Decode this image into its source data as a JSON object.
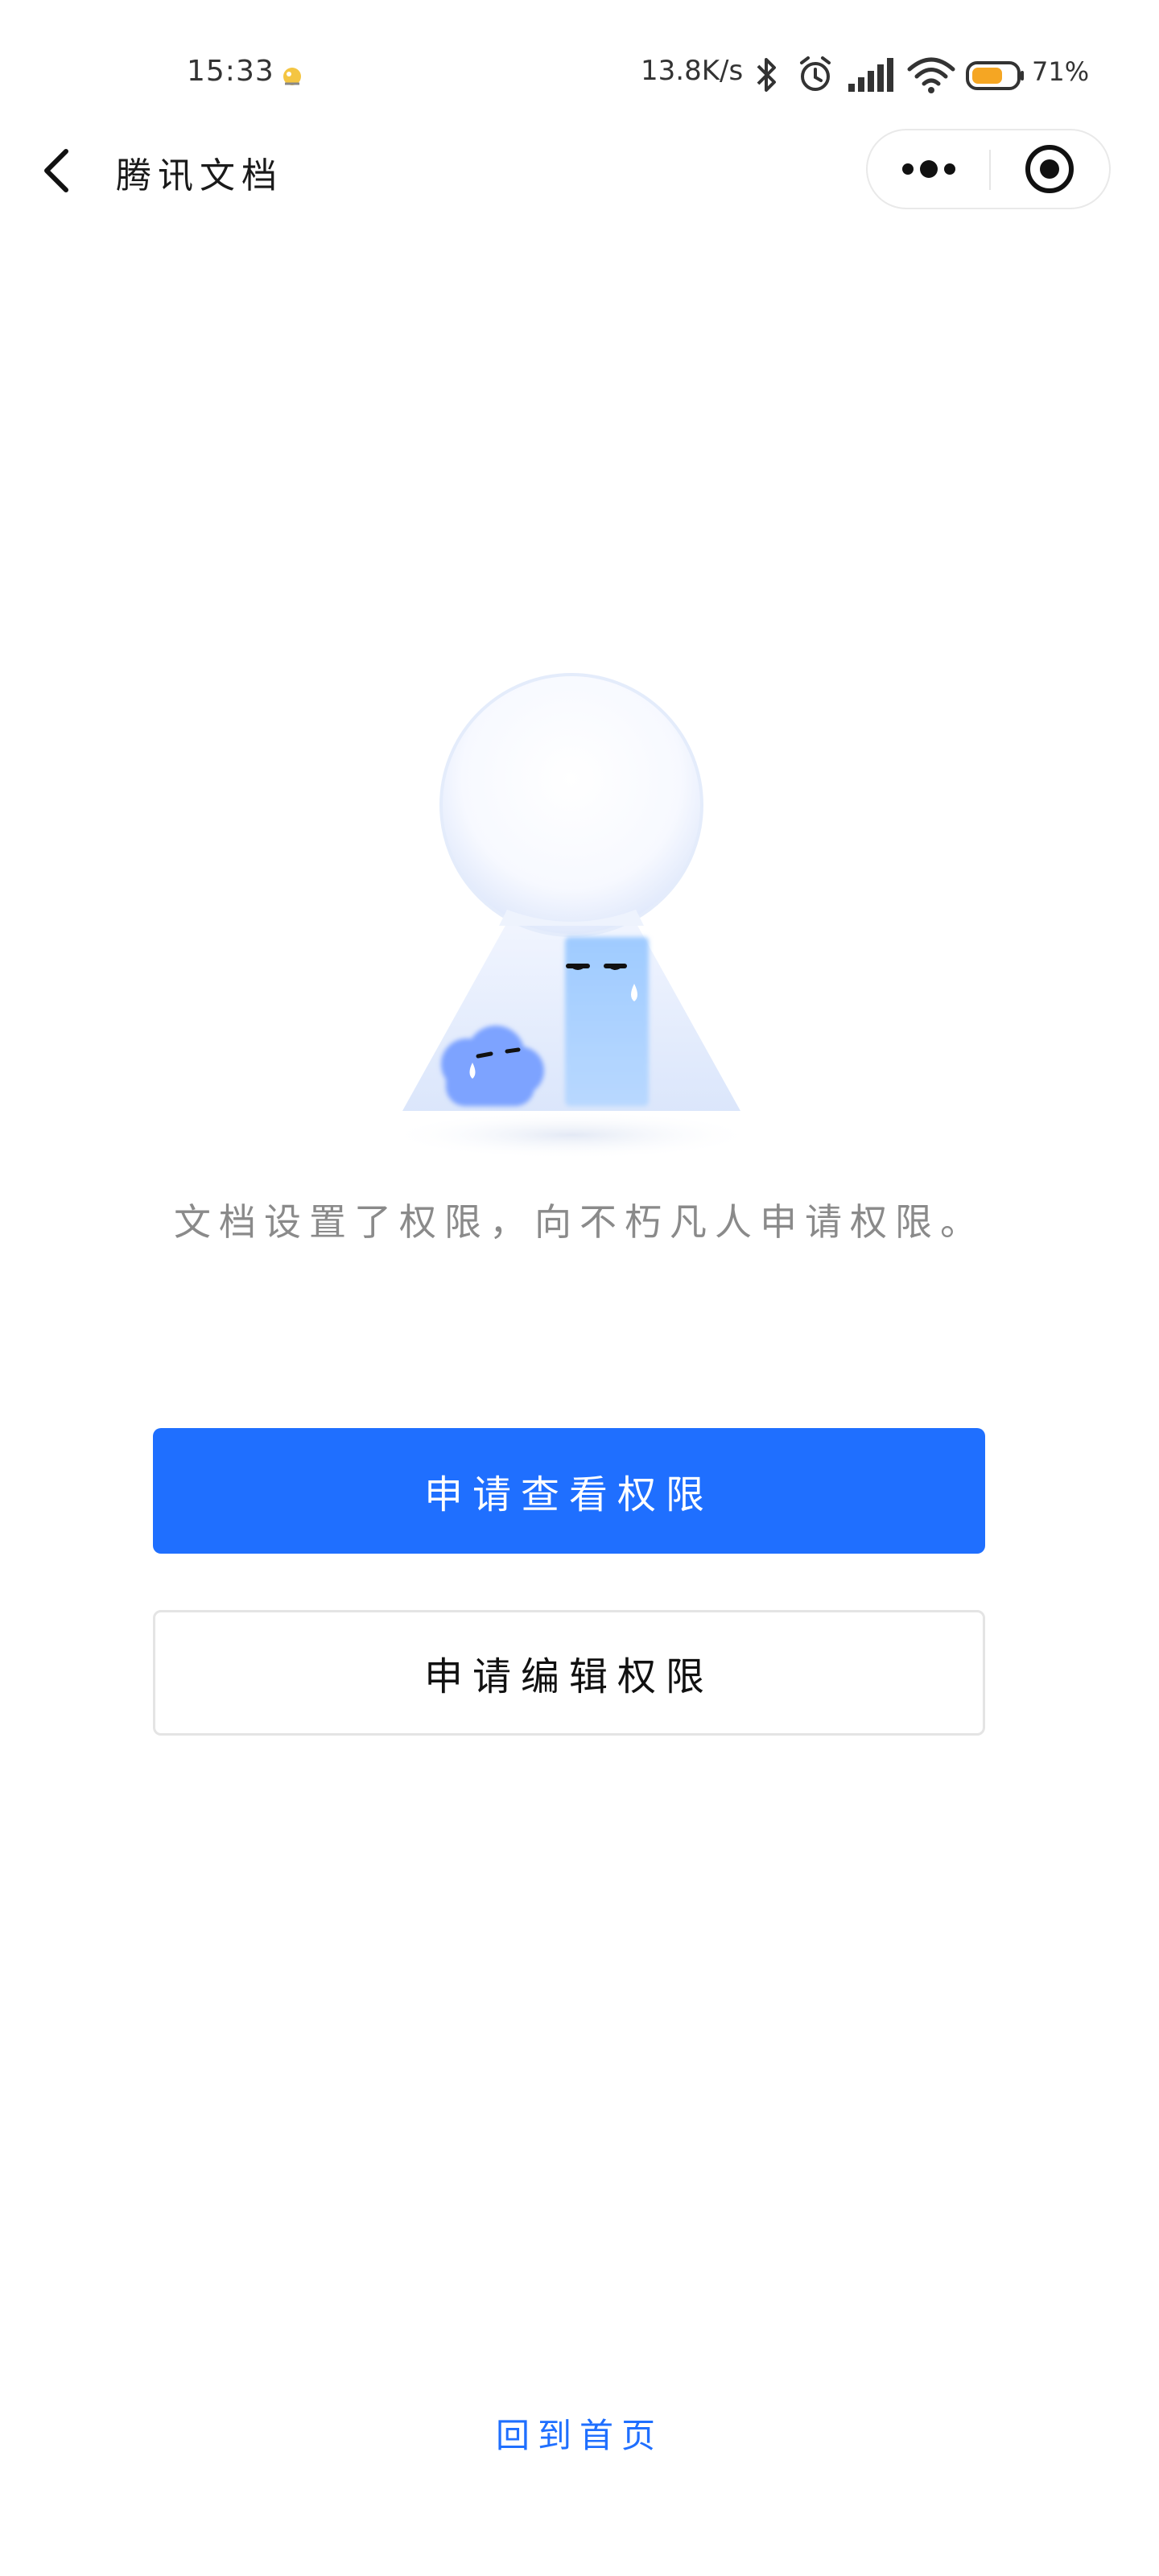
{
  "status_bar": {
    "time": "15:33",
    "network_speed": "13.8K/s",
    "battery": "71%",
    "icons": [
      "app-notification-icon",
      "bluetooth-icon",
      "alarm-icon",
      "signal-icon",
      "wifi-icon",
      "battery-icon"
    ],
    "battery_level": 0.71,
    "battery_color": "#f5a623"
  },
  "nav": {
    "title": "腾讯文档",
    "back_icon": "chevron-left-icon",
    "more_icon": "more-dots-icon",
    "close_icon": "close-miniprogram-icon"
  },
  "main": {
    "illustration": "keyhole-illustration",
    "message": "文档设置了权限，向不朽凡人申请权限。",
    "request_view_label": "申请查看权限",
    "request_edit_label": "申请编辑权限",
    "home_link": "回到首页"
  },
  "colors": {
    "accent": "#1f6fff",
    "text_muted": "#8a8a8a"
  }
}
